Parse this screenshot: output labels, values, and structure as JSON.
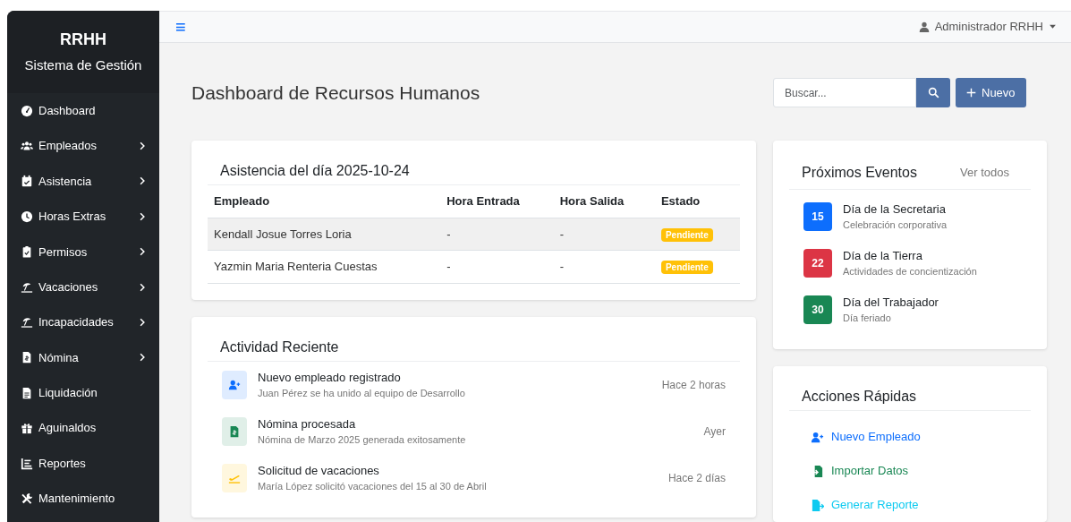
{
  "sidebar": {
    "brand": "RRHH",
    "subtitle": "Sistema de Gestión",
    "items": [
      {
        "label": "Dashboard",
        "has_submenu": false
      },
      {
        "label": "Empleados",
        "has_submenu": true
      },
      {
        "label": "Asistencia",
        "has_submenu": true
      },
      {
        "label": "Horas Extras",
        "has_submenu": true
      },
      {
        "label": "Permisos",
        "has_submenu": true
      },
      {
        "label": "Vacaciones",
        "has_submenu": true
      },
      {
        "label": "Incapacidades",
        "has_submenu": true
      },
      {
        "label": "Nómina",
        "has_submenu": true
      },
      {
        "label": "Liquidación",
        "has_submenu": false
      },
      {
        "label": "Aguinaldos",
        "has_submenu": false
      },
      {
        "label": "Reportes",
        "has_submenu": false
      },
      {
        "label": "Mantenimiento",
        "has_submenu": false
      }
    ]
  },
  "topbar": {
    "menu_toggle": "≡",
    "user": "Administrador RRHH"
  },
  "page_title": "Dashboard de Recursos Humanos",
  "search": {
    "placeholder": "Buscar..."
  },
  "new_button": "Nuevo",
  "attendance": {
    "title": "Asistencia del día 2025-10-24",
    "columns": [
      "Empleado",
      "Hora Entrada",
      "Hora Salida",
      "Estado"
    ],
    "rows": [
      {
        "employee": "Kendall Josue Torres Loria",
        "check_in": "-",
        "check_out": "-",
        "status": "Pendiente",
        "highlighted": true
      },
      {
        "employee": "Yazmin Maria Renteria Cuestas",
        "check_in": "-",
        "check_out": "-",
        "status": "Pendiente",
        "highlighted": false
      }
    ]
  },
  "activity": {
    "title": "Actividad Reciente",
    "items": [
      {
        "title": "Nuevo empleado registrado",
        "detail": "Juan Pérez se ha unido al equipo de Desarrollo",
        "time": "Hace 2 horas",
        "color": "#0d6efd"
      },
      {
        "title": "Nómina procesada",
        "detail": "Nómina de Marzo 2025 generada exitosamente",
        "time": "Ayer",
        "color": "#198754"
      },
      {
        "title": "Solicitud de vacaciones",
        "detail": "María López solicitó vacaciones del 15 al 30 de Abril",
        "time": "Hace 2 días",
        "color": "#ffc107"
      }
    ]
  },
  "events": {
    "title": "Próximos Eventos",
    "link": "Ver todos",
    "items": [
      {
        "day": "15",
        "title": "Día de la Secretaria",
        "detail": "Celebración corporativa",
        "color": "#0d6efd"
      },
      {
        "day": "22",
        "title": "Día de la Tierra",
        "detail": "Actividades de concientización",
        "color": "#dc3545"
      },
      {
        "day": "30",
        "title": "Día del Trabajador",
        "detail": "Día feriado",
        "color": "#198754"
      }
    ]
  },
  "quick_actions": {
    "title": "Acciones Rápidas",
    "items": [
      {
        "label": "Nuevo Empleado",
        "color": "#0d6efd"
      },
      {
        "label": "Importar Datos",
        "color": "#198754"
      },
      {
        "label": "Generar Reporte",
        "color": "#0dcaf0"
      }
    ]
  }
}
